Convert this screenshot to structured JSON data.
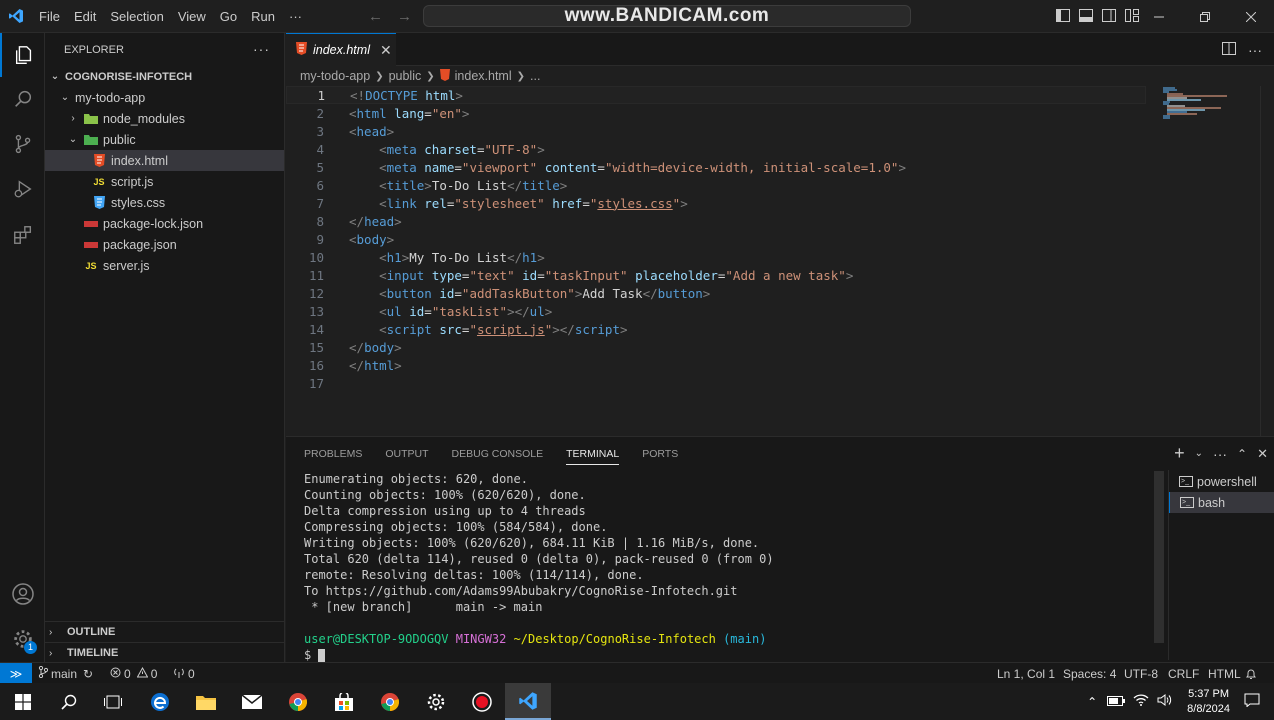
{
  "titlebar": {
    "menu": [
      "File",
      "Edit",
      "Selection",
      "View",
      "Go",
      "Run",
      "···"
    ],
    "watermark": "www.BANDICAM.com"
  },
  "sidebar": {
    "title": "EXPLORER",
    "more": "···",
    "root": "COGNORISE-INFOTECH",
    "items": [
      {
        "label": "my-todo-app",
        "chev": "⌄",
        "icon": ""
      },
      {
        "label": "node_modules",
        "chev": "›",
        "icon": "folder-green"
      },
      {
        "label": "public",
        "chev": "⌄",
        "icon": "folder-green"
      },
      {
        "label": "index.html",
        "chev": "",
        "icon": "html"
      },
      {
        "label": "script.js",
        "chev": "",
        "icon": "js"
      },
      {
        "label": "styles.css",
        "chev": "",
        "icon": "css"
      },
      {
        "label": "package-lock.json",
        "chev": "",
        "icon": "json"
      },
      {
        "label": "package.json",
        "chev": "",
        "icon": "json"
      },
      {
        "label": "server.js",
        "chev": "",
        "icon": "js"
      }
    ],
    "outline": "OUTLINE",
    "timeline": "TIMELINE"
  },
  "editor": {
    "tab_title": "index.html",
    "breadcrumb": [
      "my-todo-app",
      "public",
      "index.html",
      "..."
    ],
    "line_numbers": [
      "1",
      "2",
      "3",
      "4",
      "5",
      "6",
      "7",
      "8",
      "9",
      "10",
      "11",
      "12",
      "13",
      "14",
      "15",
      "16",
      "17"
    ]
  },
  "panel": {
    "tabs": [
      "PROBLEMS",
      "OUTPUT",
      "DEBUG CONSOLE",
      "TERMINAL",
      "PORTS"
    ],
    "terminal_lines": [
      "Enumerating objects: 620, done.",
      "Counting objects: 100% (620/620), done.",
      "Delta compression using up to 4 threads",
      "Compressing objects: 100% (584/584), done.",
      "Writing objects: 100% (620/620), 684.11 KiB | 1.16 MiB/s, done.",
      "Total 620 (delta 114), reused 0 (delta 0), pack-reused 0 (from 0)",
      "remote: Resolving deltas: 100% (114/114), done.",
      "To https://github.com/Adams99Abubakry/CognoRise-Infotech.git",
      " * [new branch]      main -> main"
    ],
    "prompt": {
      "user": "user@DESKTOP-9ODOGQV",
      "shell": "MINGW32",
      "path": "~/Desktop/CognoRise-Infotech",
      "branch": "(main)",
      "symbol": "$"
    },
    "sessions": [
      "powershell",
      "bash"
    ]
  },
  "statusbar": {
    "branch": "main",
    "errors": "0",
    "warnings": "0",
    "ports": "0",
    "position": "Ln 1, Col 1",
    "spaces": "Spaces: 4",
    "encoding": "UTF-8",
    "eol": "CRLF",
    "language": "HTML"
  },
  "taskbar": {
    "time": "5:37 PM",
    "date": "8/8/2024"
  },
  "colors": {
    "accent": "#0078d4",
    "tag": "#569cd6",
    "attr": "#9cdcfe",
    "string": "#ce9178",
    "prompt_user": "#23d18b",
    "prompt_shell": "#d670d6",
    "prompt_path": "#e5e510",
    "prompt_branch": "#29b8db"
  }
}
